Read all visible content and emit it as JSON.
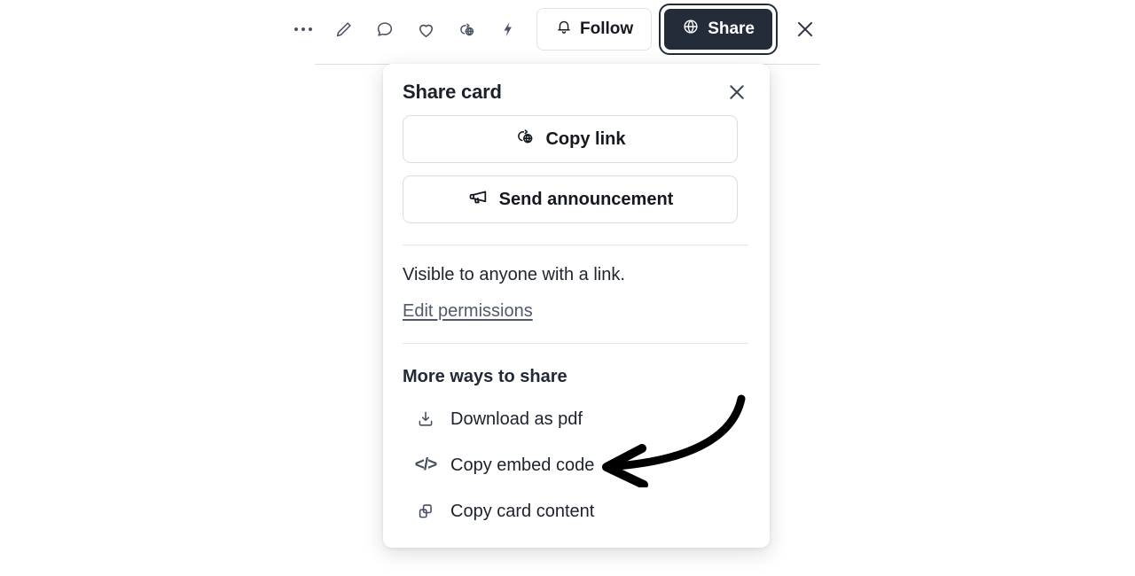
{
  "toolbar": {
    "icons": [
      {
        "name": "more-options-icon",
        "label": "More options"
      },
      {
        "name": "edit-pencil-icon",
        "label": "Edit"
      },
      {
        "name": "comment-bubble-icon",
        "label": "Comment"
      },
      {
        "name": "heart-icon",
        "label": "Like"
      },
      {
        "name": "link-globe-icon",
        "label": "Copy link"
      },
      {
        "name": "lightning-bolt-icon",
        "label": "Actions"
      }
    ],
    "follow_label": "Follow",
    "follow_icon": "bell-icon",
    "share_label": "Share",
    "share_icon": "globe-icon",
    "close_icon": "close-icon"
  },
  "share_card": {
    "title": "Share card",
    "close_icon": "close-icon",
    "primary_actions": [
      {
        "label": "Copy link",
        "icon": "link-globe-icon"
      },
      {
        "label": "Send announcement",
        "icon": "megaphone-icon"
      }
    ],
    "visibility_text": "Visible to anyone with a link.",
    "edit_permissions_label": "Edit permissions",
    "more_heading": "More ways to share",
    "more_items": [
      {
        "label": "Download as pdf",
        "icon": "download-icon"
      },
      {
        "label": "Copy embed code",
        "icon": "code-brackets-icon",
        "glyph": "</>"
      },
      {
        "label": "Copy card content",
        "icon": "copy-squares-icon"
      }
    ]
  },
  "annotation": {
    "arrow": "curved-left-arrow",
    "points_to": "Copy embed code",
    "color": "#000000"
  },
  "colors": {
    "accent_dark": "#242c3a",
    "card_background": "#ffffff",
    "border": "#d9dee6",
    "text": "#1c222c",
    "muted_text": "#515a68"
  }
}
